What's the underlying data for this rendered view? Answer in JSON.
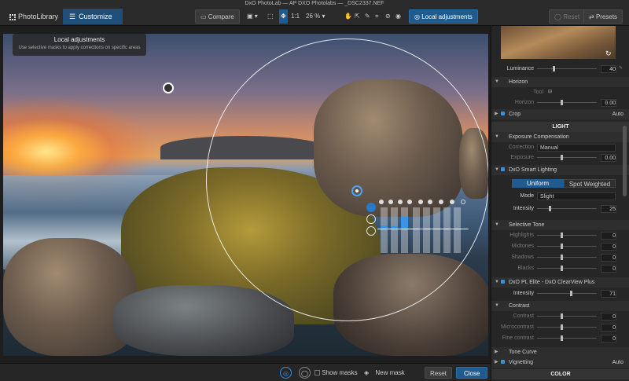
{
  "title": "DxO PhotoLab — AP DXO Photolabs — _DSC2337.NEF",
  "tabs": [
    {
      "label": "PhotoLibrary"
    },
    {
      "label": "Customize"
    }
  ],
  "toolbar": {
    "compare": "Compare",
    "ratio": "1:1",
    "zoom": "26 %",
    "local_adjust": "Local adjustments",
    "reset": "Reset",
    "presets": "Presets"
  },
  "popup": {
    "title": "Local adjustments",
    "subtitle": "Use selective masks to apply corrections on specific areas"
  },
  "bottom": {
    "show_masks": "Show masks",
    "new_mask": "New mask",
    "reset": "Reset",
    "close": "Close"
  },
  "panel": {
    "luminance": {
      "label": "Luminance",
      "value": "40"
    },
    "horizon": {
      "title": "Horizon",
      "tool": "Tool",
      "horizon": "Horizon",
      "value": "0.00"
    },
    "crop": {
      "title": "Crop",
      "auto": "Auto"
    },
    "light_section": "LIGHT",
    "exposure": {
      "title": "Exposure Compensation",
      "correction_label": "Correction",
      "correction_value": "Manual",
      "exposure_label": "Exposure",
      "exposure_value": "0.00"
    },
    "smart_lighting": {
      "title": "DxO Smart Lighting",
      "uniform": "Uniform",
      "spot": "Spot Weighted",
      "mode_label": "Mode",
      "mode_value": "Slight",
      "intensity_label": "Intensity",
      "intensity_value": "25"
    },
    "selective_tone": {
      "title": "Selective Tone",
      "rows": [
        {
          "label": "Highlights",
          "value": "0"
        },
        {
          "label": "Midtones",
          "value": "0"
        },
        {
          "label": "Shadows",
          "value": "0"
        },
        {
          "label": "Blacks",
          "value": "0"
        }
      ]
    },
    "clearview": {
      "title": "DxO PL Elite - DxO ClearView Plus",
      "intensity_label": "Intensity",
      "intensity_value": "71"
    },
    "contrast": {
      "title": "Contrast",
      "rows": [
        {
          "label": "Contrast",
          "value": "0"
        },
        {
          "label": "Microcontrast",
          "value": "0"
        },
        {
          "label": "Fine contrast",
          "value": "0"
        }
      ]
    },
    "tone_curve": "Tone Curve",
    "vignetting": {
      "title": "Vignetting",
      "auto": "Auto"
    },
    "color_section": "COLOR"
  },
  "colors": {
    "accent": "#1f5b8f",
    "highlight": "#3a93e6"
  }
}
